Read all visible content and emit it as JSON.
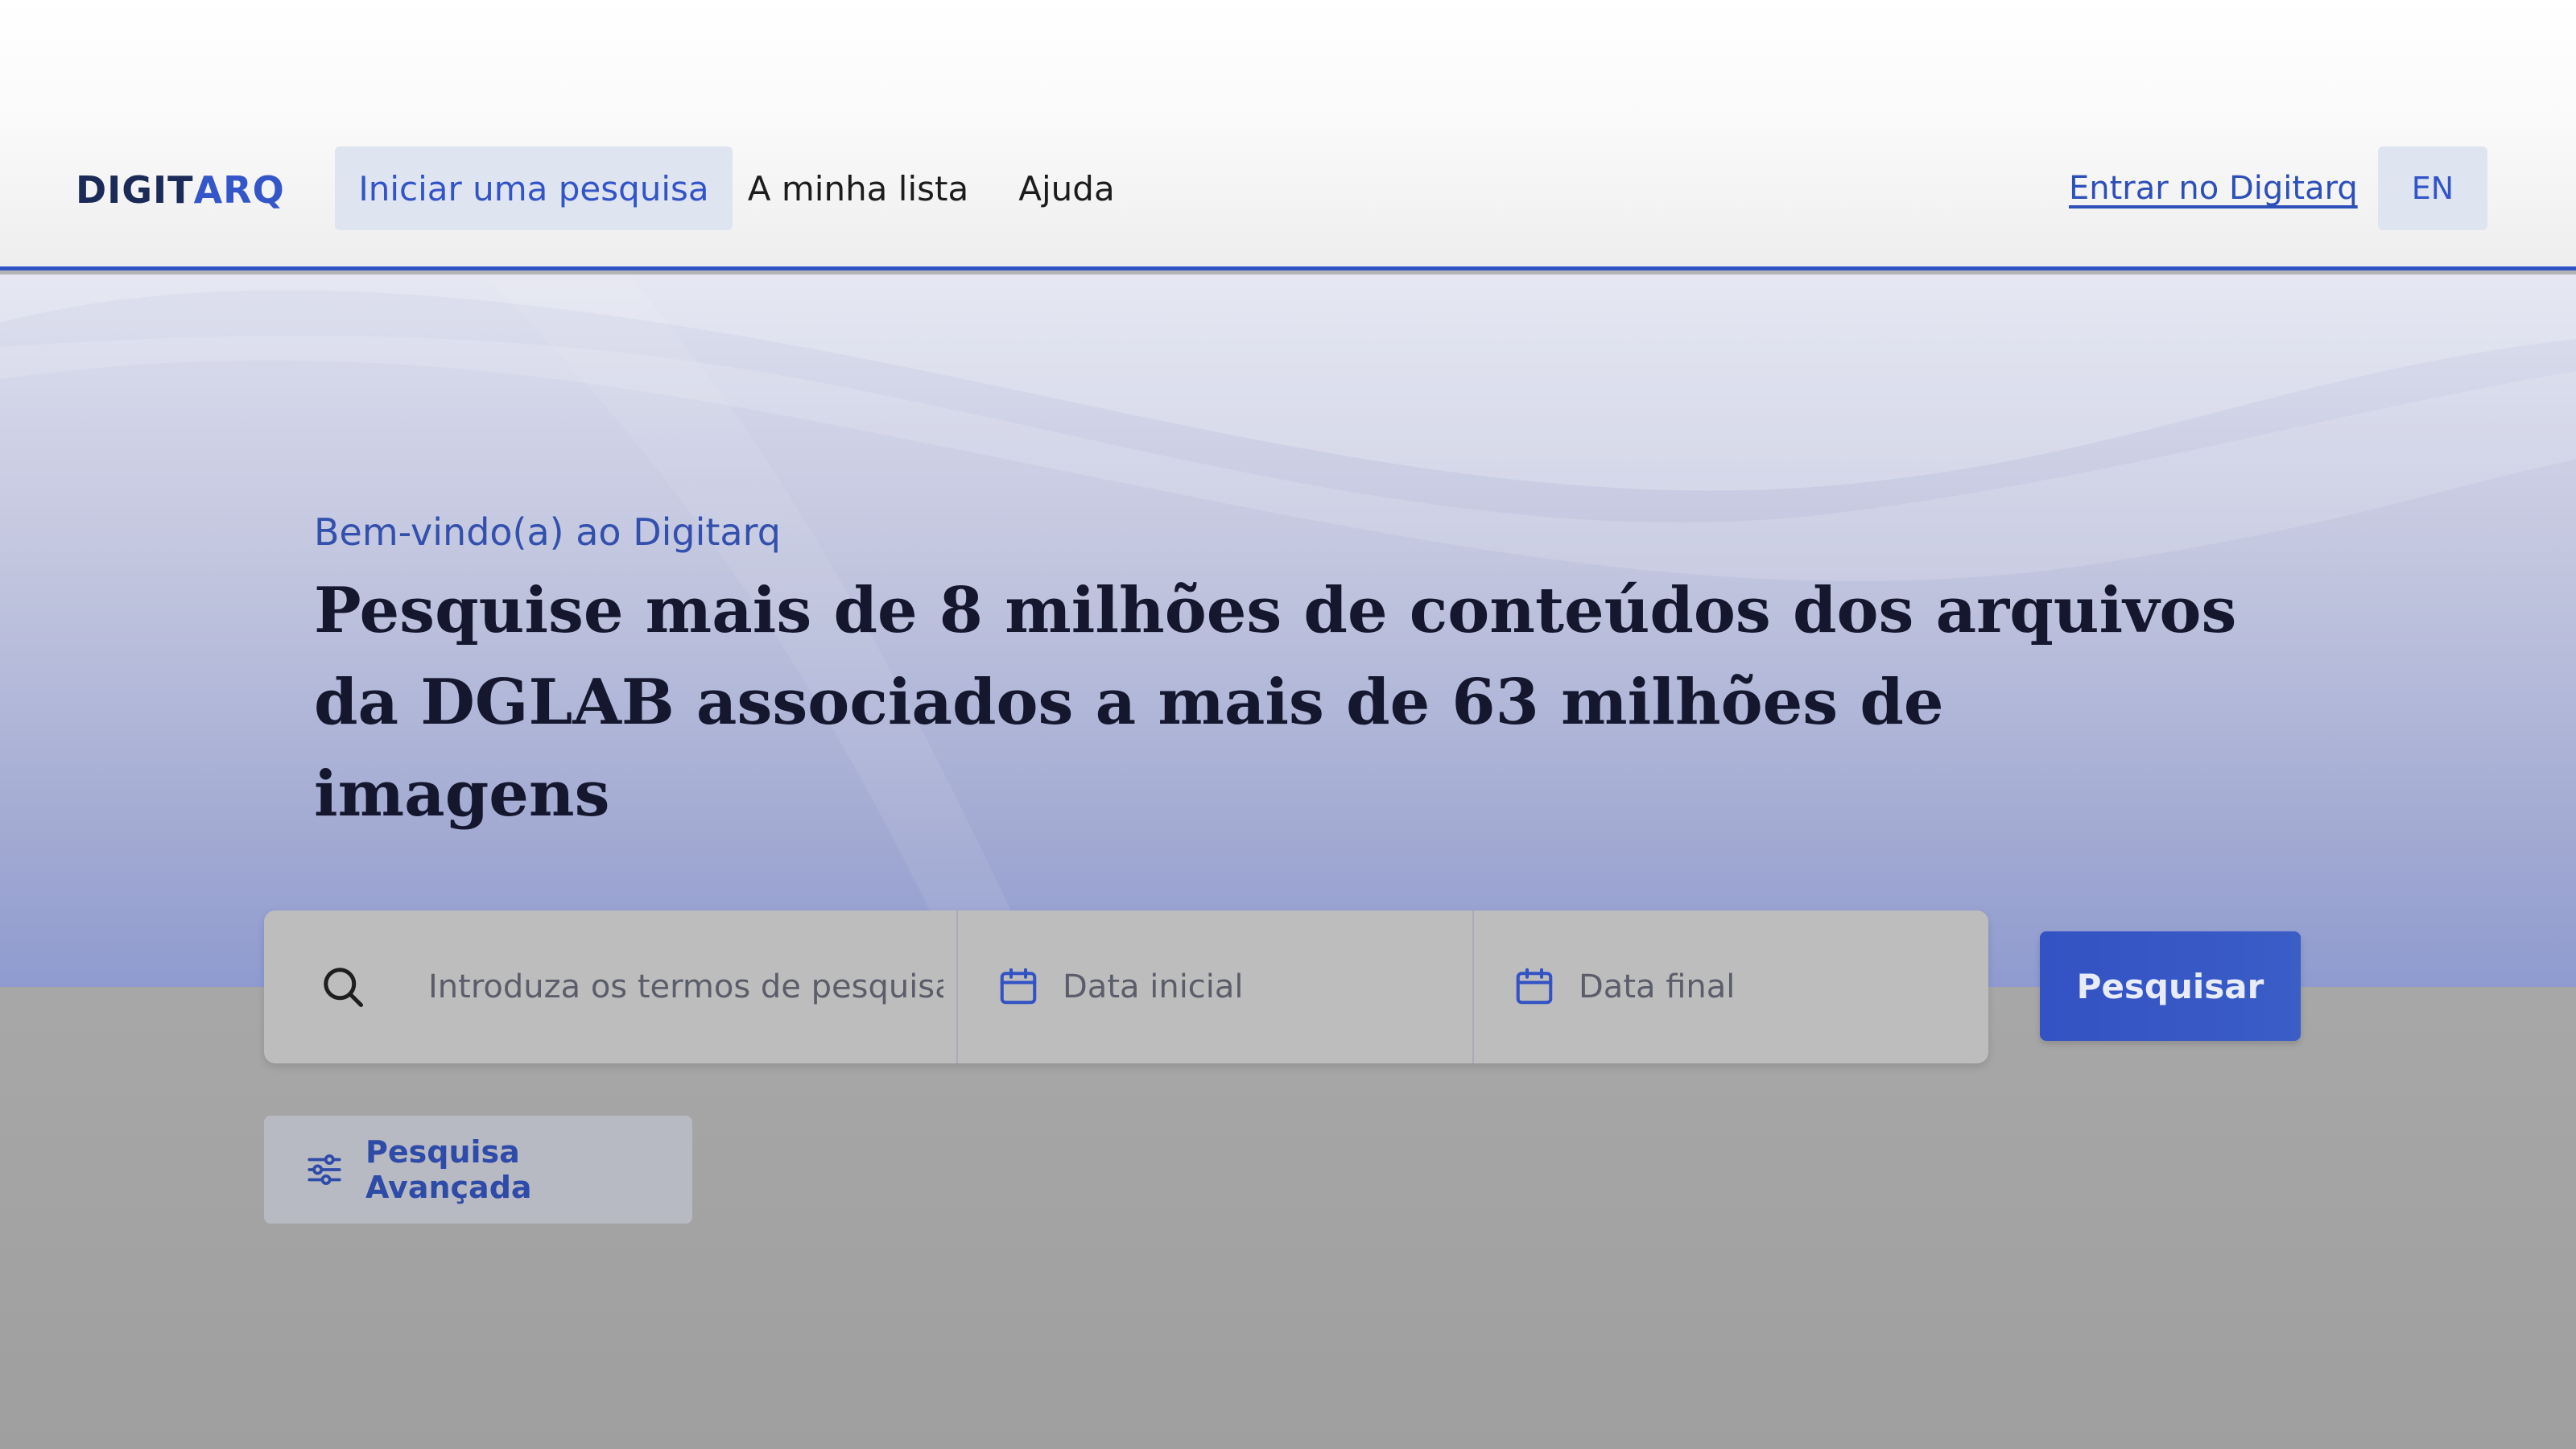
{
  "colors": {
    "accent": "#2f54c8",
    "brand_dark": "#1b2a56",
    "nav_active_bg": "#dfe4f1",
    "primary_button": "#3352c4"
  },
  "header": {
    "logo": {
      "part1": "DIGIT",
      "part2": "ARQ"
    },
    "nav": [
      {
        "label": "Iniciar uma pesquisa",
        "active": true
      },
      {
        "label": "A minha lista",
        "active": false
      },
      {
        "label": "Ajuda",
        "active": false
      }
    ],
    "login_label": "Entrar no Digitarq",
    "language_label": "EN"
  },
  "hero": {
    "welcome": "Bem-vindo(a) ao Digitarq",
    "headline_line1": "Pesquise mais de 8 milhões de conteúdos dos arquivos",
    "headline_line2": "da DGLAB associados a mais de 63 milhões de imagens"
  },
  "search": {
    "query_icon": "search-icon",
    "query_placeholder": "Introduza os termos de pesquisa",
    "start_date_icon": "calendar-icon",
    "start_date_placeholder": "Data inicial",
    "end_date_icon": "calendar-icon",
    "end_date_placeholder": "Data final",
    "submit_label": "Pesquisar",
    "advanced_icon": "sliders-icon",
    "advanced_label": "Pesquisa Avançada"
  }
}
